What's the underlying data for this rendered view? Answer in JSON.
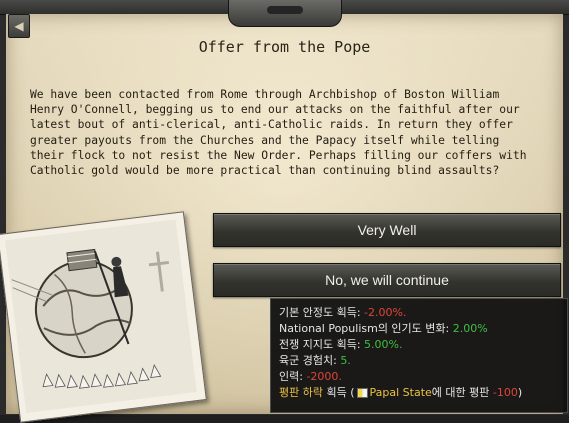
{
  "event": {
    "title": "Offer from the Pope",
    "description": "We have been contacted from Rome through Archbishop of Boston William Henry O'Connell, begging us to end our attacks on the faithful after our latest bout of anti-clerical, anti-Catholic raids. In return they offer greater payouts from the Churches and the Papacy itself while telling their flock to not resist the New Order. Perhaps filling our coffers with Catholic gold would be more practical than continuing blind assaults?",
    "back_icon": "back-arrow-icon",
    "options": [
      {
        "label": "Very Well"
      },
      {
        "label": "No, we will continue"
      }
    ]
  },
  "tooltip": {
    "stability_label": "기본 안정도 획득: ",
    "stability_value": "-2.00%.",
    "populism_label": "National Populism의 인기도 변화: ",
    "populism_value": "2.00%",
    "war_support_label": "전쟁 지지도 획득: ",
    "war_support_value": "5.00%.",
    "army_xp_label": "육군 경험치: ",
    "army_xp_value": "5.",
    "manpower_label": "인력: ",
    "manpower_value": "-2000.",
    "opinion_label": "평판 하락",
    "opinion_mid": " 획득 (",
    "opinion_country": "Papal State",
    "opinion_suffix": "에 대한 평판 ",
    "opinion_value": "-100",
    "opinion_close": ")"
  },
  "colors": {
    "negative": "#e0453a",
    "positive": "#3fbf3f",
    "highlight": "#e9c245"
  }
}
